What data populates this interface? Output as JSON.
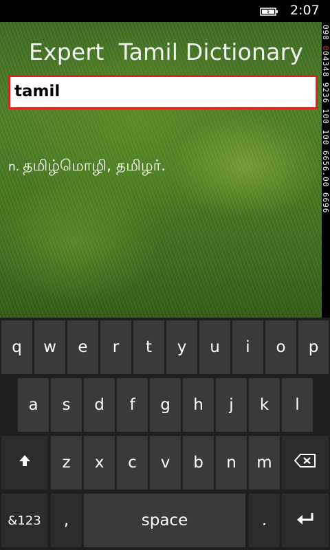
{
  "status_bar": {
    "time": "2:07",
    "battery_icon": "battery-charging-icon"
  },
  "app": {
    "title": "Expert  Tamil Dictionary",
    "search": {
      "value": "tamil"
    },
    "result": {
      "part_of_speech": "n.",
      "definition": " தமிழ்மொழி, தமிழர்."
    }
  },
  "ad_strip": {
    "text_prefix": "090 ",
    "text_red": "0",
    "text_rest": "04348 9236 100 100 6656.00 6696"
  },
  "keyboard": {
    "row1": [
      "q",
      "w",
      "e",
      "r",
      "t",
      "y",
      "u",
      "i",
      "o",
      "p"
    ],
    "row2": [
      "a",
      "s",
      "d",
      "f",
      "g",
      "h",
      "j",
      "k",
      "l"
    ],
    "row3": [
      "z",
      "x",
      "c",
      "v",
      "b",
      "n",
      "m"
    ],
    "shift_icon": "shift-arrow-icon",
    "backspace_icon": "backspace-icon",
    "enter_icon": "enter-icon",
    "symbols_label": "&123",
    "comma_label": ",",
    "space_label": "space",
    "period_label": "."
  }
}
